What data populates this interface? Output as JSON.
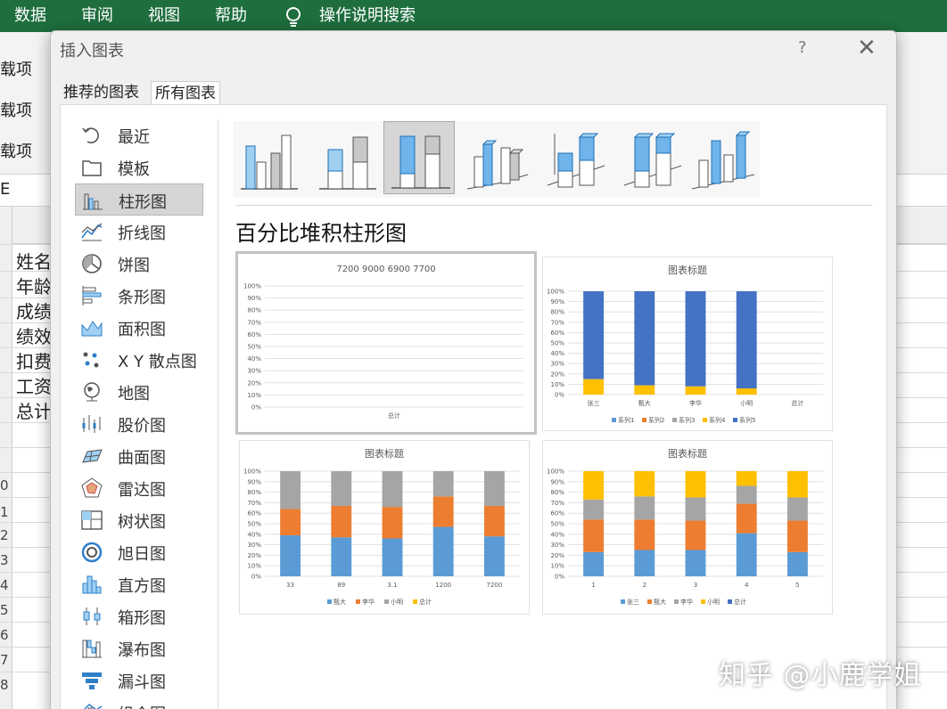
{
  "excel": {
    "ribbon_tabs": [
      "数据",
      "审阅",
      "视图",
      "帮助"
    ],
    "tell_me": "操作说明搜索",
    "ribbon_left": [
      "载项",
      "载项",
      "载项"
    ],
    "formula_left": "E",
    "rows": [
      "姓名",
      "年龄",
      "成绩",
      "绩效",
      "扣费",
      "工资",
      "总计"
    ],
    "row_numbers": [
      "0",
      "1",
      "2",
      "3",
      "4",
      "5",
      "6",
      "7",
      "8"
    ]
  },
  "dialog": {
    "title": "插入图表",
    "help": "?",
    "close": "✕",
    "tabs": [
      "推荐的图表",
      "所有图表"
    ],
    "categories": [
      {
        "label": "最近",
        "icon": "recent-icon"
      },
      {
        "label": "模板",
        "icon": "folder-icon"
      },
      {
        "label": "柱形图",
        "icon": "column-chart-icon",
        "selected": true
      },
      {
        "label": "折线图",
        "icon": "line-chart-icon"
      },
      {
        "label": "饼图",
        "icon": "pie-chart-icon"
      },
      {
        "label": "条形图",
        "icon": "bar-chart-icon"
      },
      {
        "label": "面积图",
        "icon": "area-chart-icon"
      },
      {
        "label": "X Y 散点图",
        "icon": "scatter-chart-icon"
      },
      {
        "label": "地图",
        "icon": "map-chart-icon"
      },
      {
        "label": "股价图",
        "icon": "stock-chart-icon"
      },
      {
        "label": "曲面图",
        "icon": "surface-chart-icon"
      },
      {
        "label": "雷达图",
        "icon": "radar-chart-icon"
      },
      {
        "label": "树状图",
        "icon": "treemap-chart-icon"
      },
      {
        "label": "旭日图",
        "icon": "sunburst-chart-icon"
      },
      {
        "label": "直方图",
        "icon": "histogram-chart-icon"
      },
      {
        "label": "箱形图",
        "icon": "box-chart-icon"
      },
      {
        "label": "瀑布图",
        "icon": "waterfall-chart-icon"
      },
      {
        "label": "漏斗图",
        "icon": "funnel-chart-icon"
      },
      {
        "label": "组合图",
        "icon": "combo-chart-icon"
      }
    ],
    "section_title": "百分比堆积柱形图",
    "colors": {
      "blue": "#5b9bd5",
      "orange": "#ed7d31",
      "gray": "#a5a5a5",
      "yellow": "#ffc000",
      "darkblue": "#4472c4"
    }
  },
  "chart_data": [
    {
      "type": "bar",
      "title": "7200 9000 6900 7700",
      "categories": [
        "总计"
      ],
      "series": [],
      "ylim": [
        0,
        100
      ],
      "yticks": [
        "100%",
        "90%",
        "80%",
        "70%",
        "60%",
        "50%",
        "40%",
        "30%",
        "20%",
        "10%",
        "0%"
      ]
    },
    {
      "type": "bar",
      "title": "图表标题",
      "categories": [
        "张三",
        "甄大",
        "李华",
        "小明",
        "总计"
      ],
      "series": [
        {
          "name": "系列1",
          "values": [
            0,
            0,
            0,
            0,
            0
          ]
        },
        {
          "name": "系列2",
          "values": [
            0,
            0,
            0,
            0,
            0
          ]
        },
        {
          "name": "系列3",
          "values": [
            0,
            0,
            0,
            0,
            0
          ]
        },
        {
          "name": "系列4",
          "values": [
            15,
            9,
            8,
            6,
            0
          ]
        },
        {
          "name": "系列5",
          "values": [
            85,
            91,
            92,
            94,
            0
          ]
        }
      ],
      "ylim": [
        0,
        100
      ],
      "yticks": [
        "100%",
        "90%",
        "80%",
        "70%",
        "60%",
        "50%",
        "40%",
        "30%",
        "20%",
        "10%",
        "0%"
      ]
    },
    {
      "type": "bar",
      "title": "图表标题",
      "categories": [
        "33",
        "89",
        "3.1",
        "1200",
        "7200"
      ],
      "series": [
        {
          "name": "甄大",
          "values": [
            39,
            37,
            36,
            47,
            38
          ]
        },
        {
          "name": "李华",
          "values": [
            25,
            30,
            30,
            29,
            29
          ]
        },
        {
          "name": "小明",
          "values": [
            36,
            33,
            34,
            24,
            33
          ]
        },
        {
          "name": "总计",
          "values": [
            0,
            0,
            0,
            0,
            0
          ]
        }
      ],
      "ylim": [
        0,
        100
      ],
      "yticks": [
        "100%",
        "90%",
        "80%",
        "70%",
        "60%",
        "50%",
        "40%",
        "30%",
        "20%",
        "10%",
        "0%"
      ]
    },
    {
      "type": "bar",
      "title": "图表标题",
      "categories": [
        "1",
        "2",
        "3",
        "4",
        "5"
      ],
      "series": [
        {
          "name": "张三",
          "values": [
            23,
            25,
            25,
            41,
            23
          ]
        },
        {
          "name": "甄大",
          "values": [
            31,
            29,
            28,
            28,
            30
          ]
        },
        {
          "name": "李华",
          "values": [
            19,
            22,
            22,
            17,
            22
          ]
        },
        {
          "name": "小明",
          "values": [
            27,
            24,
            25,
            14,
            25
          ]
        },
        {
          "name": "总计",
          "values": [
            0,
            0,
            0,
            0,
            0
          ]
        }
      ],
      "ylim": [
        0,
        100
      ],
      "yticks": [
        "100%",
        "90%",
        "80%",
        "70%",
        "60%",
        "50%",
        "40%",
        "30%",
        "20%",
        "10%",
        "0%"
      ]
    }
  ],
  "watermark": "知乎 @小鹿学姐"
}
